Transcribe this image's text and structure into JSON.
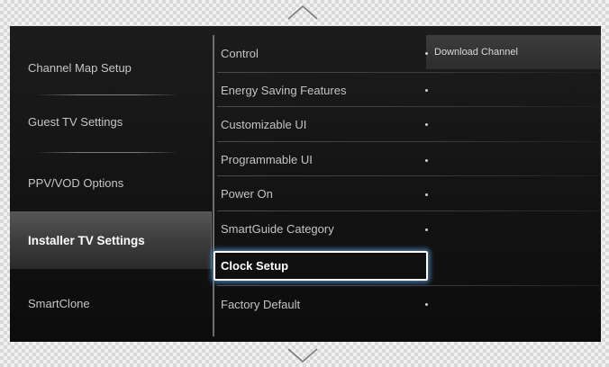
{
  "left_menu": {
    "items": [
      {
        "label": "Channel Map Setup"
      },
      {
        "label": "Guest TV Settings"
      },
      {
        "label": "PPV/VOD Options"
      },
      {
        "label": "Installer TV Settings"
      },
      {
        "label": "SmartClone"
      }
    ],
    "active": "Installer TV Settings"
  },
  "middle_menu": {
    "items": [
      {
        "label": "Control"
      },
      {
        "label": "Energy Saving Features"
      },
      {
        "label": "Customizable UI"
      },
      {
        "label": "Programmable UI"
      },
      {
        "label": "Power On"
      },
      {
        "label": "SmartGuide Category"
      },
      {
        "label": "Clock Setup"
      },
      {
        "label": "Factory Default"
      }
    ],
    "selected": "Clock Setup"
  },
  "submenu": {
    "label": "Download Channel"
  },
  "icons": {
    "scroll_up": "chevron-up-icon",
    "scroll_down": "chevron-down-icon"
  }
}
